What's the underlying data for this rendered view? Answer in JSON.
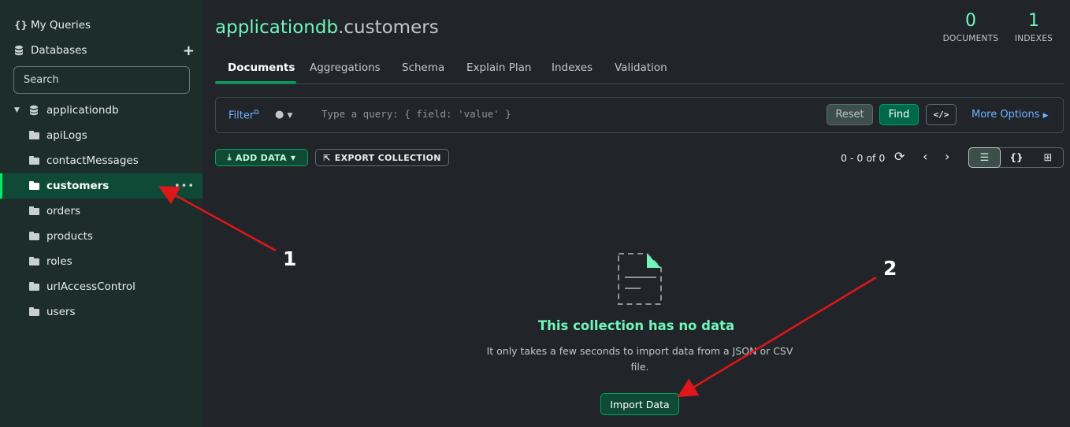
{
  "sidebar": {
    "my_queries": "My Queries",
    "databases": "Databases",
    "add_icon": "plus-icon",
    "search_placeholder": "Search",
    "database": {
      "name": "applicationdb"
    },
    "collections": [
      {
        "name": "apiLogs"
      },
      {
        "name": "contactMessages"
      },
      {
        "name": "customers",
        "active": true
      },
      {
        "name": "orders"
      },
      {
        "name": "products"
      },
      {
        "name": "roles"
      },
      {
        "name": "urlAccessControl"
      },
      {
        "name": "users"
      }
    ],
    "more_icon": "ellipsis-icon"
  },
  "header": {
    "db_name": "applicationdb",
    "coll_name": ".customers",
    "documents_count": "0",
    "documents_label": "DOCUMENTS",
    "indexes_count": "1",
    "indexes_label": "INDEXES"
  },
  "tabs": [
    {
      "label": "Documents",
      "active": true
    },
    {
      "label": "Aggregations"
    },
    {
      "label": "Schema"
    },
    {
      "label": "Explain Plan"
    },
    {
      "label": "Indexes"
    },
    {
      "label": "Validation"
    }
  ],
  "query": {
    "filter_label": "Filter",
    "placeholder": "Type a query: { field: 'value' }",
    "reset": "Reset",
    "find": "Find",
    "code_icon": "code-icon",
    "more_options": "More Options"
  },
  "toolbar": {
    "add_data": "ADD DATA",
    "export": "EXPORT COLLECTION",
    "pager": "0 - 0 of 0"
  },
  "empty": {
    "title": "This collection has no data",
    "description": "It only takes a few seconds to import data from a JSON or CSV file.",
    "import_button": "Import Data"
  },
  "annotations": [
    {
      "label": "1"
    },
    {
      "label": "2"
    }
  ],
  "colors": {
    "accent": "#00ed64",
    "title_green": "#71f6ba",
    "annotation_arrow": "#e0161a"
  }
}
